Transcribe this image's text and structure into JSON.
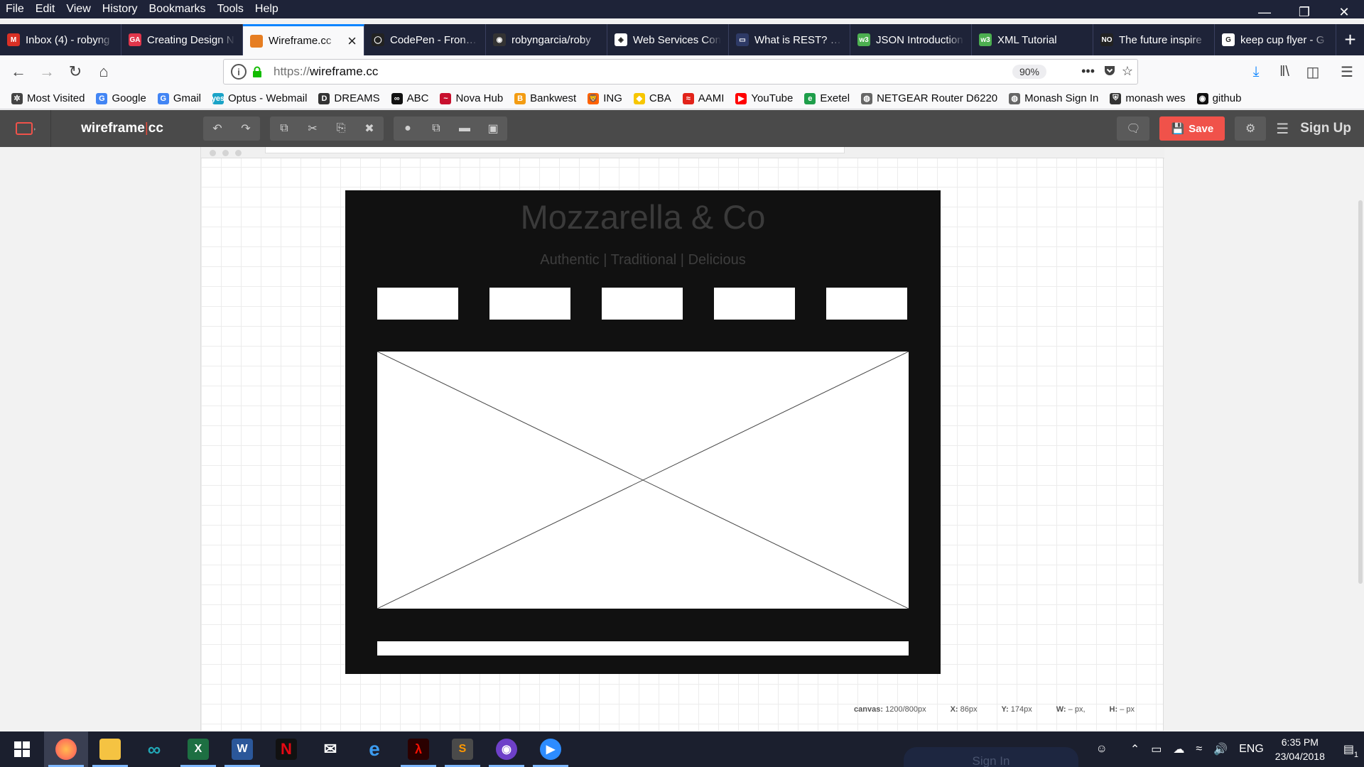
{
  "menubar": [
    "File",
    "Edit",
    "View",
    "History",
    "Bookmarks",
    "Tools",
    "Help"
  ],
  "tabs": [
    {
      "label": "Inbox (4) - robyng",
      "icon": "gmail-icon",
      "color": "#d93025",
      "glyph": "M"
    },
    {
      "label": "Creating Design N",
      "icon": "ga-icon",
      "color": "#e0364b",
      "glyph": "GA"
    },
    {
      "label": "Wireframe.cc",
      "icon": "wireframe-icon",
      "color": "#e67e22",
      "glyph": "",
      "active": true
    },
    {
      "label": "CodePen - Front E",
      "icon": "codepen-icon",
      "color": "#222222",
      "glyph": "◯"
    },
    {
      "label": "robyngarcia/roby",
      "icon": "github-icon",
      "color": "#333333",
      "glyph": "◉"
    },
    {
      "label": "Web Services Con",
      "icon": "webservices-icon",
      "color": "#ffffff",
      "glyph": "◈"
    },
    {
      "label": "What is REST? | C",
      "icon": "doc-icon",
      "color": "#2e3a66",
      "glyph": "▭"
    },
    {
      "label": "JSON Introduction",
      "icon": "w3schools-icon",
      "color": "#4caf50",
      "glyph": "w3"
    },
    {
      "label": "XML Tutorial",
      "icon": "w3schools-icon",
      "color": "#4caf50",
      "glyph": "w3"
    },
    {
      "label": "The future inspire",
      "icon": "site-icon",
      "color": "#222222",
      "glyph": "NO"
    },
    {
      "label": "keep cup flyer - G",
      "icon": "google-icon",
      "color": "#ffffff",
      "glyph": "G"
    }
  ],
  "nav": {
    "url_prefix": "https://",
    "url_host": "wireframe.cc",
    "zoom": "90%"
  },
  "bookmarks": [
    {
      "label": "Most Visited",
      "icon": "gear-icon",
      "color": "#444444",
      "glyph": "✲"
    },
    {
      "label": "Google",
      "icon": "google-icon",
      "color": "#4285f4",
      "glyph": "G"
    },
    {
      "label": "Gmail",
      "icon": "google-icon",
      "color": "#4285f4",
      "glyph": "G"
    },
    {
      "label": "Optus - Webmail",
      "icon": "optus-icon",
      "color": "#1aa3c7",
      "glyph": "yes"
    },
    {
      "label": "DREAMS",
      "icon": "dreams-icon",
      "color": "#333333",
      "glyph": "D"
    },
    {
      "label": "ABC",
      "icon": "abc-icon",
      "color": "#111111",
      "glyph": "∞"
    },
    {
      "label": "Nova Hub",
      "icon": "nova-icon",
      "color": "#c8102e",
      "glyph": "~"
    },
    {
      "label": "Bankwest",
      "icon": "bankwest-icon",
      "color": "#f39c12",
      "glyph": "B"
    },
    {
      "label": "ING",
      "icon": "ing-icon",
      "color": "#ff6200",
      "glyph": "🦁"
    },
    {
      "label": "CBA",
      "icon": "cba-icon",
      "color": "#f7c600",
      "glyph": "◆"
    },
    {
      "label": "AAMI",
      "icon": "aami-icon",
      "color": "#e2231a",
      "glyph": "≈"
    },
    {
      "label": "YouTube",
      "icon": "youtube-icon",
      "color": "#ff0000",
      "glyph": "▶"
    },
    {
      "label": "Exetel",
      "icon": "exetel-icon",
      "color": "#1e9e4a",
      "glyph": "e"
    },
    {
      "label": "NETGEAR Router D6220",
      "icon": "globe-icon",
      "color": "#666666",
      "glyph": "◍"
    },
    {
      "label": "Monash Sign In",
      "icon": "globe-icon",
      "color": "#666666",
      "glyph": "◍"
    },
    {
      "label": "monash wes",
      "icon": "monash-icon",
      "color": "#333333",
      "glyph": "⛨"
    },
    {
      "label": "github",
      "icon": "github-icon",
      "color": "#111111",
      "glyph": "◉"
    }
  ],
  "app": {
    "brand_left": "wireframe",
    "brand_pipe": "|",
    "brand_right": "cc",
    "save_label": "Save",
    "signup_label": "Sign Up",
    "accent": "#f0524a"
  },
  "wireframe": {
    "title": "Mozzarella & Co",
    "tagline": "Authentic | Traditional | Delicious",
    "nav_box_count": 5
  },
  "status": {
    "canvas_label": "canvas:",
    "canvas_value": "1200/800px",
    "x_label": "X:",
    "x_value": "86px",
    "y_label": "Y:",
    "y_value": "174px",
    "w_label": "W:",
    "w_value": "– px,",
    "h_label": "H:",
    "h_value": "– px"
  },
  "taskbar": {
    "time": "6:35 PM",
    "date": "23/04/2018",
    "lang": "ENG",
    "notification_count": "1",
    "ghost_label": "Sign In"
  }
}
